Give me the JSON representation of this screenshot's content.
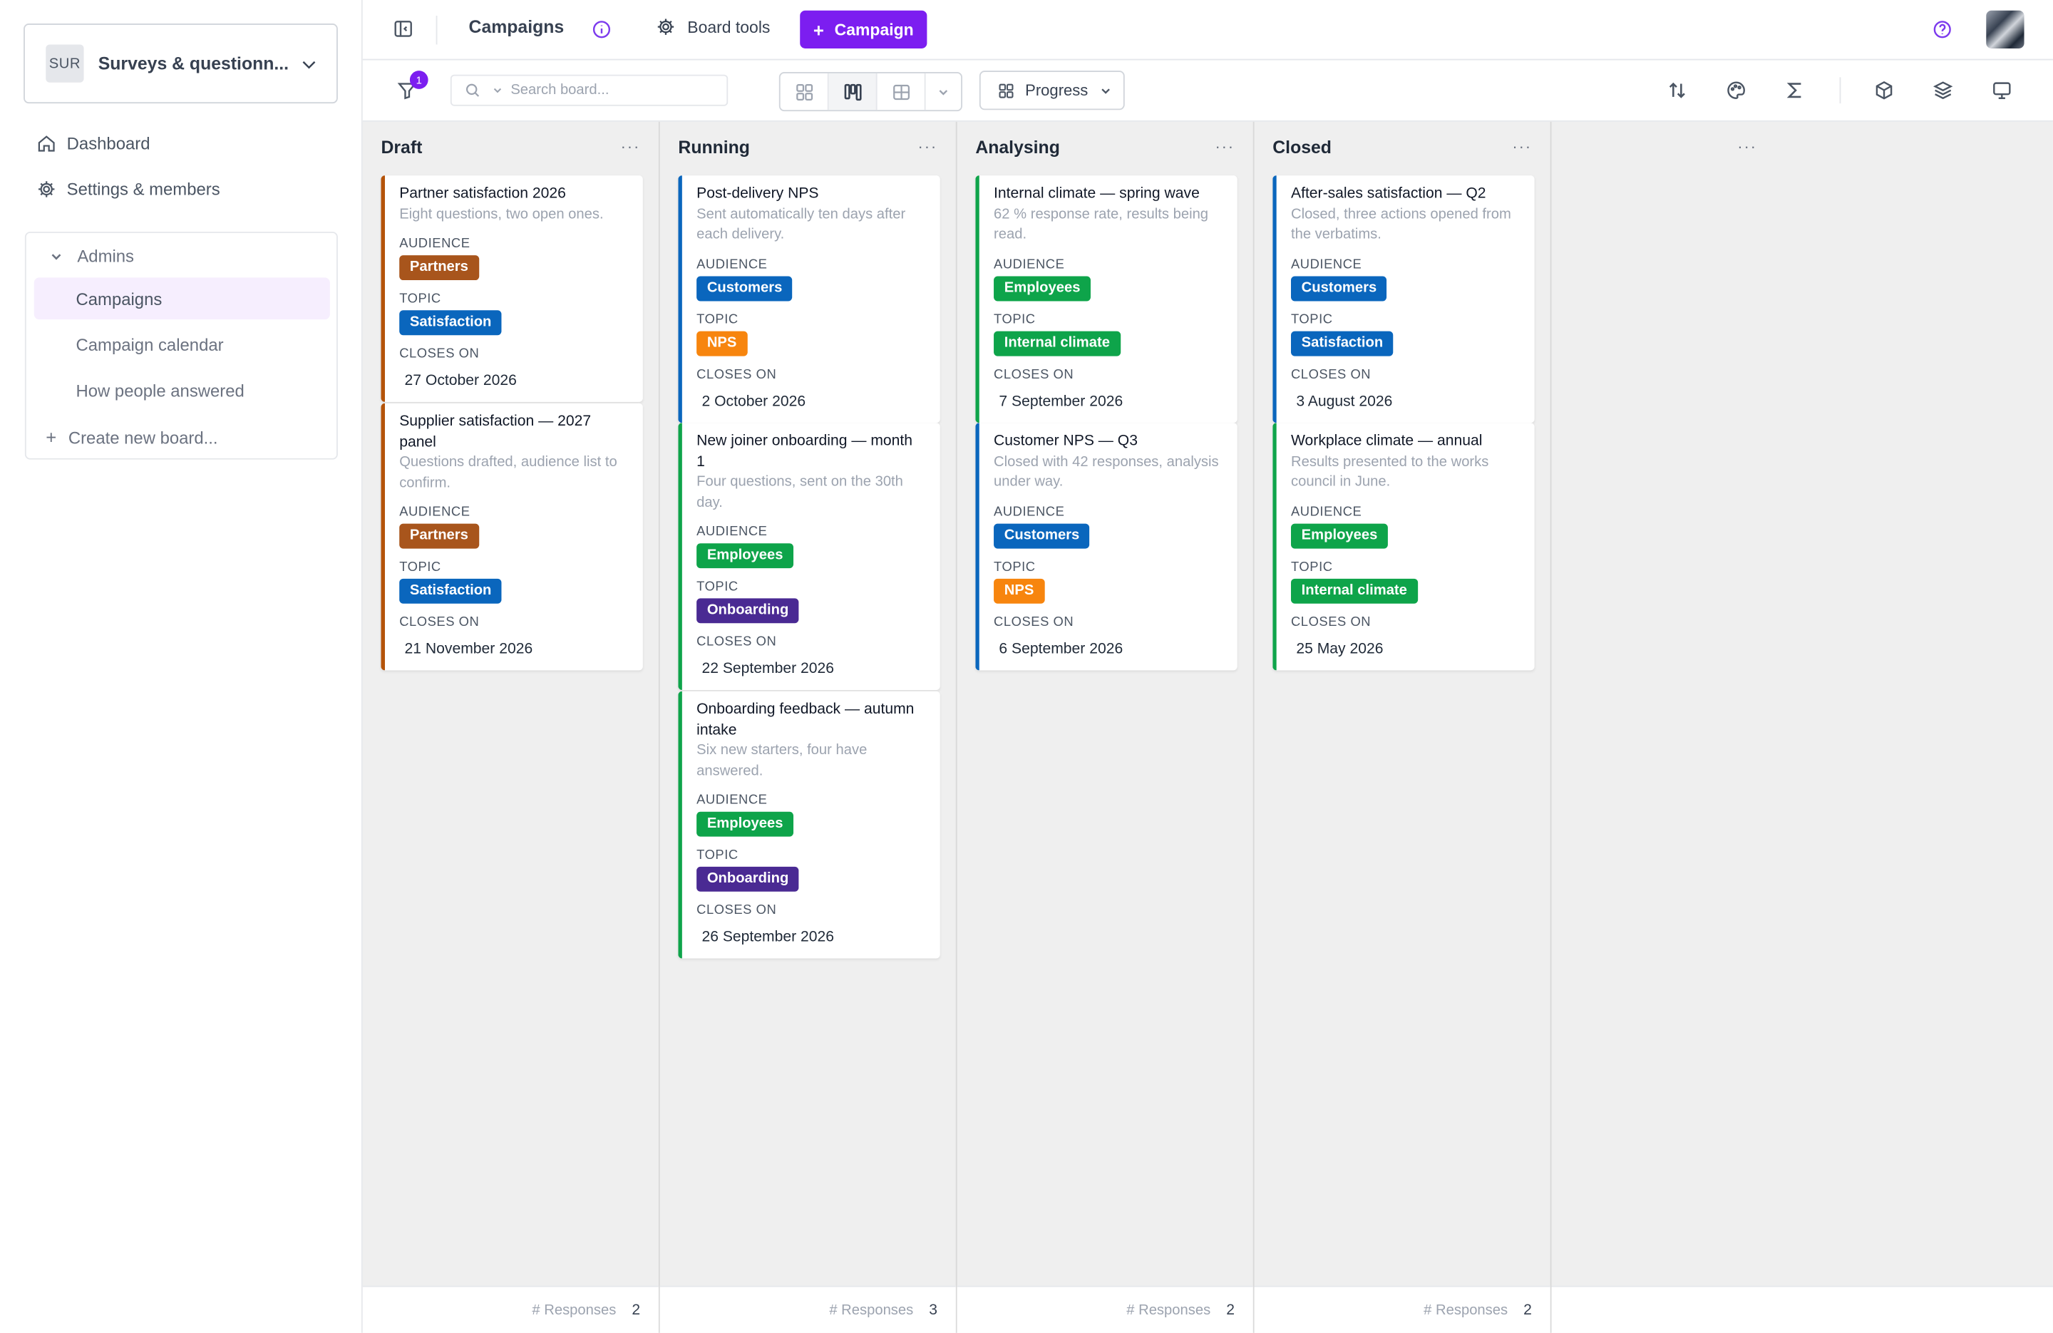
{
  "workspace": {
    "badge": "SUR",
    "name": "Surveys & questionn..."
  },
  "nav": {
    "dashboard": "Dashboard",
    "settings": "Settings & members"
  },
  "group": {
    "name": "Admins",
    "items": [
      "Campaigns",
      "Campaign calendar",
      "How people answered"
    ],
    "active": "Campaigns",
    "create": "Create new board..."
  },
  "topbar": {
    "title": "Campaigns",
    "board_tools": "Board tools",
    "cta": "Campaign"
  },
  "toolbar": {
    "filter_count": "1",
    "search_placeholder": "Search board...",
    "group_by": "Progress"
  },
  "labels": {
    "audience": "AUDIENCE",
    "topic": "TOPIC",
    "closes_on": "CLOSES ON"
  },
  "footer_label": "# Responses",
  "colors": {
    "accent": "#7c1ef0",
    "partners": "#a8551c",
    "customers": "#0a66bd",
    "employees": "#0ea44a",
    "satisfaction": "#0a66bd",
    "nps": "#f7850e",
    "internal_climate": "#0ea44a",
    "onboarding": "#4a2a93"
  },
  "columns": [
    {
      "name": "Draft",
      "count": "2",
      "cards": [
        {
          "title": "Partner satisfaction 2026",
          "desc": "Eight questions, two open ones.",
          "audience": "Partners",
          "topic": "Satisfaction",
          "closes": "27 October 2026"
        },
        {
          "title": "Supplier satisfaction — 2027 panel",
          "desc": "Questions drafted, audience list to confirm.",
          "audience": "Partners",
          "topic": "Satisfaction",
          "closes": "21 November 2026"
        }
      ]
    },
    {
      "name": "Running",
      "count": "3",
      "cards": [
        {
          "title": "Post-delivery NPS",
          "desc": "Sent automatically ten days after each delivery.",
          "audience": "Customers",
          "topic": "NPS",
          "closes": "2 October 2026"
        },
        {
          "title": "New joiner onboarding — month 1",
          "desc": "Four questions, sent on the 30th day.",
          "audience": "Employees",
          "topic": "Onboarding",
          "closes": "22 September 2026"
        },
        {
          "title": "Onboarding feedback — autumn intake",
          "desc": "Six new starters, four have answered.",
          "audience": "Employees",
          "topic": "Onboarding",
          "closes": "26 September 2026"
        }
      ]
    },
    {
      "name": "Analysing",
      "count": "2",
      "cards": [
        {
          "title": "Internal climate — spring wave",
          "desc": "62 % response rate, results being read.",
          "audience": "Employees",
          "topic": "Internal climate",
          "closes": "7 September 2026"
        },
        {
          "title": "Customer NPS — Q3",
          "desc": "Closed with 42 responses, analysis under way.",
          "audience": "Customers",
          "topic": "NPS",
          "closes": "6 September 2026"
        }
      ]
    },
    {
      "name": "Closed",
      "count": "2",
      "cards": [
        {
          "title": "After-sales satisfaction — Q2",
          "desc": "Closed, three actions opened from the verbatims.",
          "audience": "Customers",
          "topic": "Satisfaction",
          "closes": "3 August 2026"
        },
        {
          "title": "Workplace climate — annual",
          "desc": "Results presented to the works council in June.",
          "audience": "Employees",
          "topic": "Internal climate",
          "closes": "25 May 2026"
        }
      ]
    }
  ]
}
